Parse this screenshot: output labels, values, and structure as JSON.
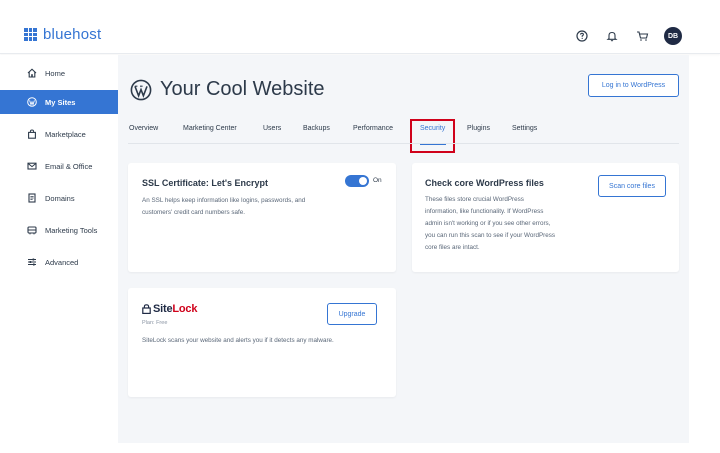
{
  "brand": {
    "name": "bluehost",
    "color": "#3575d3"
  },
  "header": {
    "help_icon": "help-circle-icon",
    "bell_icon": "bell-icon",
    "cart_icon": "cart-icon",
    "avatar_initials": "DB"
  },
  "sidebar": {
    "items": [
      {
        "label": "Home",
        "icon": "home-icon",
        "active": false
      },
      {
        "label": "My Sites",
        "icon": "wordpress-icon",
        "active": true
      },
      {
        "label": "Marketplace",
        "icon": "bag-icon",
        "active": false
      },
      {
        "label": "Email & Office",
        "icon": "mail-icon",
        "active": false
      },
      {
        "label": "Domains",
        "icon": "document-icon",
        "active": false
      },
      {
        "label": "Marketing Tools",
        "icon": "megaphone-icon",
        "active": false
      },
      {
        "label": "Advanced",
        "icon": "sliders-icon",
        "active": false
      }
    ]
  },
  "site": {
    "title": "Your Cool Website",
    "login_button": "Log in to WordPress"
  },
  "tabs": [
    {
      "label": "Overview"
    },
    {
      "label": "Marketing Center"
    },
    {
      "label": "Users"
    },
    {
      "label": "Backups"
    },
    {
      "label": "Performance"
    },
    {
      "label": "Security",
      "active": true
    },
    {
      "label": "Plugins"
    },
    {
      "label": "Settings"
    }
  ],
  "ssl_card": {
    "title": "SSL Certificate: Let's Encrypt",
    "toggle_label": "On",
    "toggle_on": true,
    "desc_line1": "An SSL helps keep information like logins, passwords, and",
    "desc_line2": "customers' credit card numbers safe."
  },
  "wp_files_card": {
    "title": "Check core WordPress files",
    "button": "Scan core files",
    "desc_lines": [
      "These files store crucial WordPress",
      "information, like functionality. If WordPress",
      "admin isn't working or if you see other errors,",
      "you can run this scan to see if your WordPress",
      "core files are intact."
    ]
  },
  "sitelock_card": {
    "logo_part1": "Site",
    "logo_part2": "Lock",
    "plan": "Plan: Free",
    "button": "Upgrade",
    "desc": "SiteLock scans your website and alerts you if it detects any malware."
  },
  "colors": {
    "accent": "#3575d3",
    "highlight": "#d0021b",
    "background": "#f4f6f9"
  }
}
